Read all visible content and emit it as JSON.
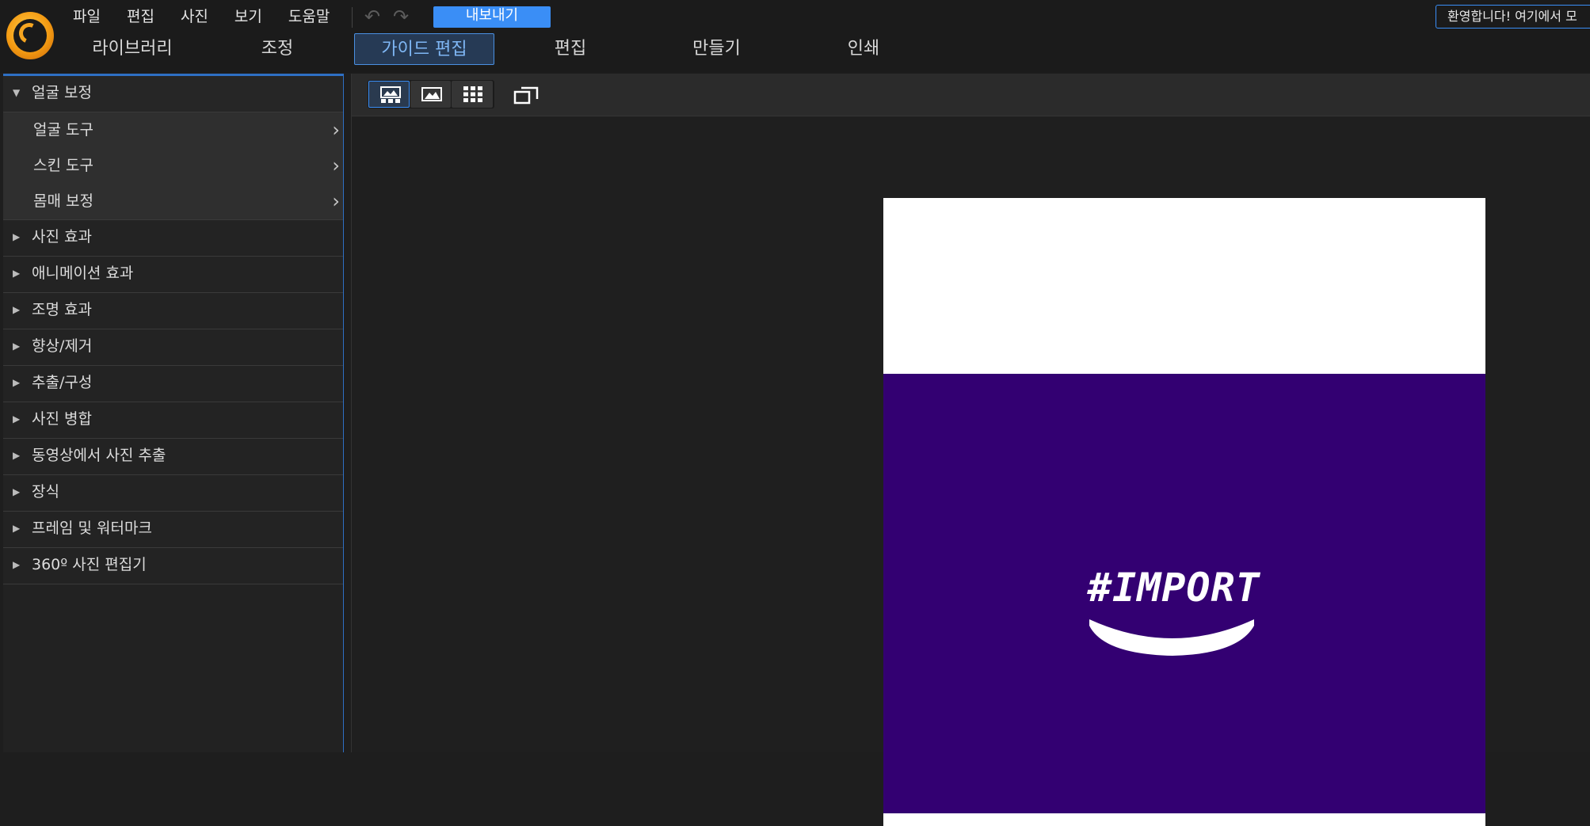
{
  "menu": [
    "파일",
    "편집",
    "사진",
    "보기",
    "도움말"
  ],
  "export_label": "내보내기",
  "welcome_text": "환영합니다! 여기에서 모",
  "mode_tabs": [
    "라이브러리",
    "조정",
    "가이드 편집",
    "편집",
    "만들기",
    "인쇄"
  ],
  "active_mode": "가이드 편집",
  "panel": {
    "open_category": "얼굴 보정",
    "open_items": [
      "얼굴 도구",
      "스킨 도구",
      "몸매 보정"
    ],
    "categories": [
      "사진 효과",
      "애니메이션 효과",
      "조명 효과",
      "향상/제거",
      "추출/구성",
      "사진 병합",
      "동영상에서 사진 추출",
      "장식",
      "프레임 및 워터마크",
      "360º 사진 편집기"
    ]
  },
  "photo": {
    "brand_text": "#IMPORT",
    "colors": {
      "purple": "#330072",
      "white": "#ffffff"
    }
  },
  "colors": {
    "accent": "#3a8ef6",
    "active_tab_text": "#7fb7f5"
  },
  "icons": {
    "undo": "undo-arrow-icon",
    "redo": "redo-arrow-icon",
    "view_filmstrip": "filmstrip-view-icon",
    "view_single": "single-photo-view-icon",
    "view_grid": "grid-view-icon",
    "resize": "fit-window-icon"
  }
}
